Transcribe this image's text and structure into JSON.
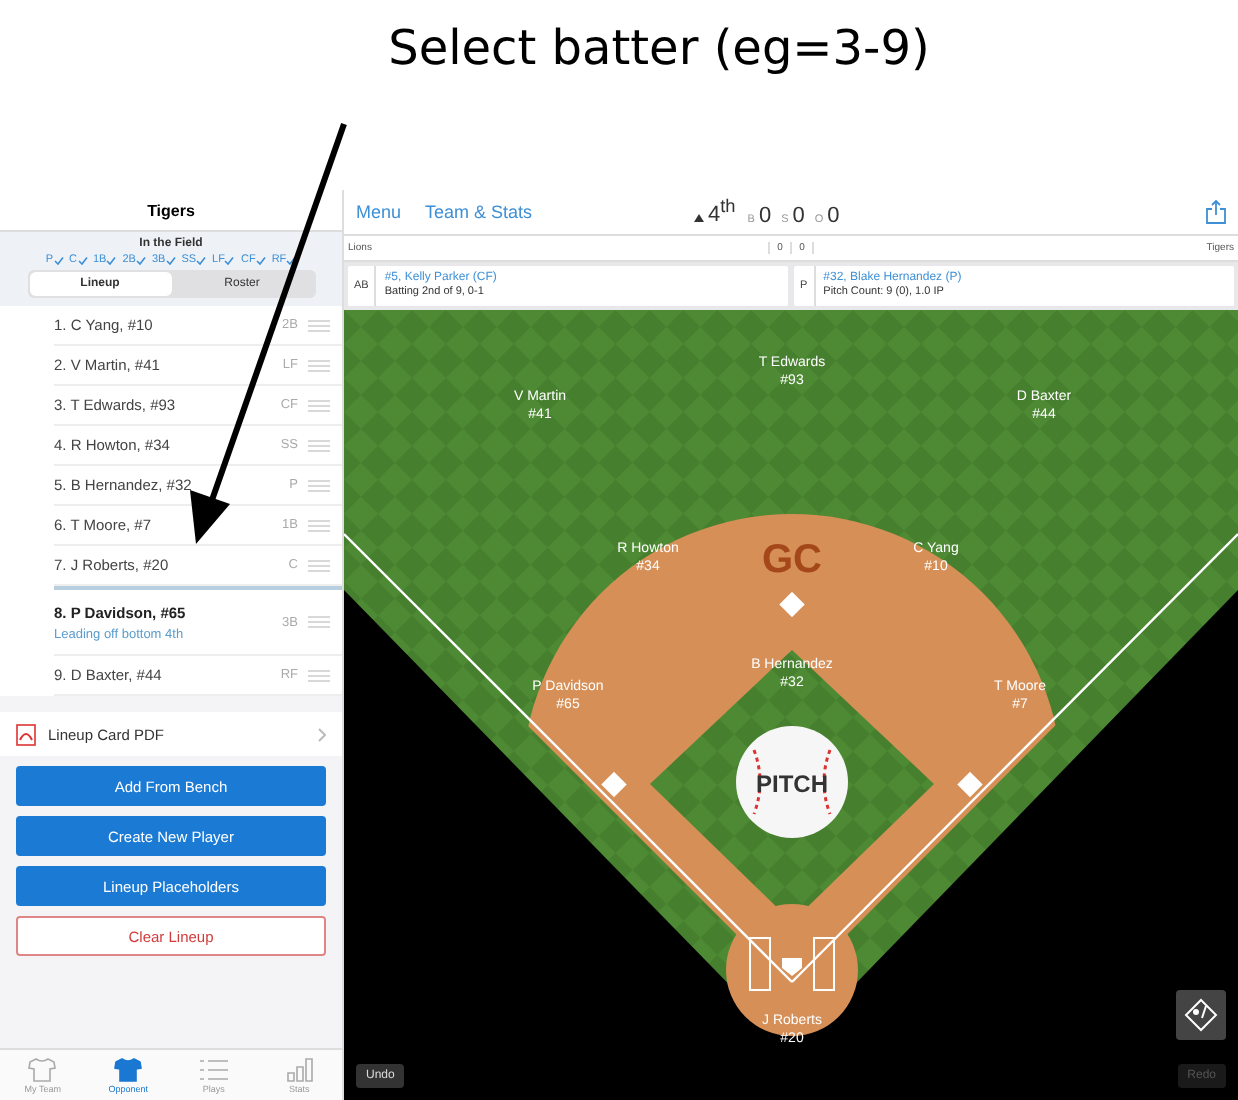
{
  "annotation": {
    "text": "Select batter (eg=3-9)"
  },
  "sidebar": {
    "team": "Tigers",
    "field_title": "In the Field",
    "field_checks": [
      {
        "label": "P",
        "checked": true
      },
      {
        "label": "C",
        "checked": true
      },
      {
        "label": "1B",
        "checked": true
      },
      {
        "label": "2B",
        "checked": true
      },
      {
        "label": "3B",
        "checked": true
      },
      {
        "label": "SS",
        "checked": true
      },
      {
        "label": "LF",
        "checked": true
      },
      {
        "label": "CF",
        "checked": true
      },
      {
        "label": "RF",
        "checked": true
      }
    ],
    "tabs": [
      {
        "label": "Lineup",
        "selected": true
      },
      {
        "label": "Roster",
        "selected": false
      }
    ],
    "lineup": [
      {
        "name": "1. C Yang, #10",
        "position": "2B",
        "selected": false
      },
      {
        "name": "2. V Martin, #41",
        "position": "LF",
        "selected": false
      },
      {
        "name": "3. T Edwards, #93",
        "position": "CF",
        "selected": false
      },
      {
        "name": "4. R Howton, #34",
        "position": "SS",
        "selected": false
      },
      {
        "name": "5. B Hernandez, #32",
        "position": "P",
        "selected": false
      },
      {
        "name": "6. T Moore, #7",
        "position": "1B",
        "selected": false
      },
      {
        "name": "7. J Roberts, #20",
        "position": "C",
        "selected": false
      },
      {
        "name": "8. P Davidson, #65",
        "position": "3B",
        "selected": true,
        "note": "Leading off bottom 4th"
      },
      {
        "name": "9. D Baxter, #44",
        "position": "RF",
        "selected": false
      }
    ],
    "pdf_row": "Lineup Card PDF",
    "buttons": [
      {
        "label": "Add From Bench",
        "kind": "primary"
      },
      {
        "label": "Create New Player",
        "kind": "primary"
      },
      {
        "label": "Lineup Placeholders",
        "kind": "primary"
      },
      {
        "label": "Clear Lineup",
        "kind": "danger"
      }
    ],
    "tab_bar": [
      {
        "label": "My Team",
        "selected": false
      },
      {
        "label": "Opponent",
        "selected": true
      },
      {
        "label": "Plays",
        "selected": false
      },
      {
        "label": "Stats",
        "selected": false
      }
    ]
  },
  "top_bar": {
    "links": [
      "Menu",
      "Team & Stats"
    ],
    "inning": "4$^{th}$",
    "top_half": true,
    "counts": [
      {
        "label": "B",
        "value": "0"
      },
      {
        "label": "S",
        "value": "0"
      },
      {
        "label": "O",
        "value": "0"
      }
    ]
  },
  "scoreboard": {
    "away": {
      "name": "Lions",
      "runs": "0"
    },
    "home": {
      "name": "Tigers",
      "runs": "0"
    }
  },
  "cards": [
    {
      "tag": "AB",
      "name": "#5, Kelly Parker (CF)",
      "detail": "Batting 2nd of 9, 0-1"
    },
    {
      "tag": "P",
      "name": "#32, Blake Hernandez (P)",
      "detail": "Pitch Count: 9 (0), 1.0 IP"
    }
  ],
  "field": {
    "logo": "GC",
    "pitch_button": "PITCH",
    "fielders": [
      {
        "name": "V Martin",
        "number": "#41"
      },
      {
        "name": "T Edwards",
        "number": "#93"
      },
      {
        "name": "D Baxter",
        "number": "#44"
      },
      {
        "name": "R Howton",
        "number": "#34"
      },
      {
        "name": "C Yang",
        "number": "#10"
      },
      {
        "name": "B Hernandez",
        "number": "#32"
      },
      {
        "name": "P Davidson",
        "number": "#65"
      },
      {
        "name": "T Moore",
        "number": "#7"
      },
      {
        "name": "J Roberts",
        "number": "#20"
      }
    ],
    "undo": {
      "label": "Undo",
      "disabled": false
    },
    "redo": {
      "label": "Redo",
      "disabled": true
    }
  }
}
